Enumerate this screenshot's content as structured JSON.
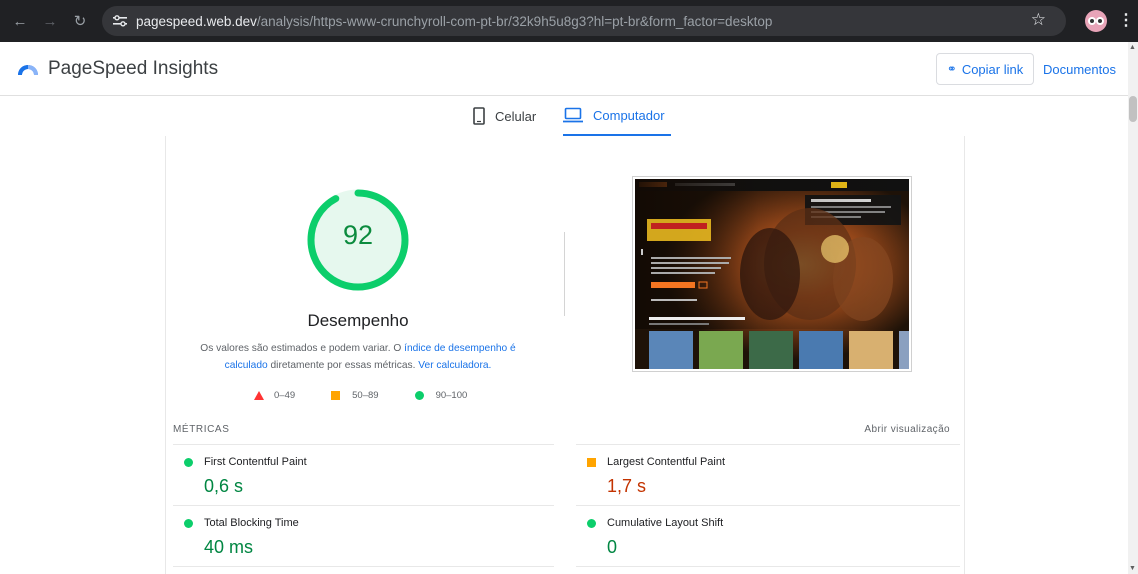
{
  "browser": {
    "url_host": "pagespeed.web.dev",
    "url_path": "/analysis/https-www-crunchyroll-com-pt-br/32k9h5u8g3?hl=pt-br&form_factor=desktop"
  },
  "header": {
    "title": "PageSpeed Insights",
    "copy_link": "Copiar link",
    "docs": "Documentos"
  },
  "tabs": [
    {
      "label": "Celular",
      "icon": "smartphone-icon",
      "active": false
    },
    {
      "label": "Computador",
      "icon": "laptop-icon",
      "active": true
    }
  ],
  "report": {
    "score": 92,
    "category": "Desempenho",
    "desc_part1": "Os valores são estimados e podem variar. O ",
    "desc_link1": "índice de desempenho é calculado",
    "desc_part2": " diretamente por essas métricas. ",
    "desc_link2": "Ver calculadora.",
    "legend": [
      {
        "range": "0–49",
        "color": "#ff3333"
      },
      {
        "range": "50–89",
        "color": "#ffa400"
      },
      {
        "range": "90–100",
        "color": "#0cce6b"
      }
    ],
    "metrics_label": "MÉTRICAS",
    "open_view": "Abrir visualização",
    "metrics": [
      {
        "name": "First Contentful Paint",
        "value": "0,6 s",
        "rating": "good"
      },
      {
        "name": "Largest Contentful Paint",
        "value": "1,7 s",
        "rating": "average"
      },
      {
        "name": "Total Blocking Time",
        "value": "40 ms",
        "rating": "good"
      },
      {
        "name": "Cumulative Layout Shift",
        "value": "0",
        "rating": "good"
      }
    ]
  },
  "colors": {
    "accent": "#1a73e8",
    "good": "#0cce6b",
    "average": "#ffa400",
    "poor": "#ff3333"
  }
}
